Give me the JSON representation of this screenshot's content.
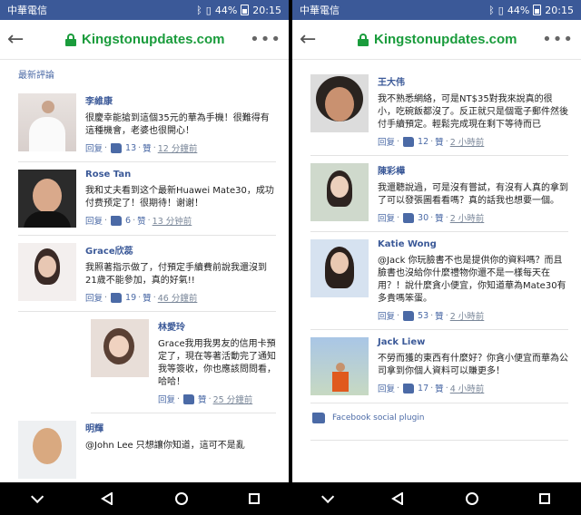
{
  "status": {
    "carrier": "中華電信",
    "signal": "⁴ᴳ",
    "battery": "44%",
    "time": "20:15"
  },
  "urlbar": {
    "domain": "Kingstonupdates.com",
    "more": "•••"
  },
  "left": {
    "section_title": "最新評論",
    "comments": [
      {
        "author": "李維康",
        "text": "很慶幸能搶到這個35元的華為手機！很難得有這種機會，老婆也很開心！",
        "reply": "回复",
        "likes": "13",
        "praise": "贊",
        "time": "12 分鐘前",
        "avatar": "av-wedding",
        "indent": false
      },
      {
        "author": "Rose Tan",
        "text": "我和丈夫看到这个最新Huawei Mate30，成功付费预定了！很期待！谢谢！",
        "reply": "回复",
        "likes": "6",
        "praise": "赞",
        "time": "13 分钟前",
        "avatar": "av-rose",
        "indent": false
      },
      {
        "author": "Grace欣蕊",
        "text": "我照著指示做了，付預定手續費前說我還沒到21歲不能參加，真的好氣!!",
        "reply": "回复",
        "likes": "19",
        "praise": "贊",
        "time": "46 分鐘前",
        "avatar": "av-grace",
        "indent": false
      },
      {
        "author": "林愛玲",
        "text": "Grace我用我男友的信用卡預定了，現在等著活動完了通知我等簽收，你也應該問問看，哈哈！",
        "reply": "回复",
        "likes": "",
        "praise": "贊",
        "time": "25 分鐘前",
        "avatar": "av-lin",
        "indent": true
      },
      {
        "author": "明輝",
        "text": "@John Lee 只想讓你知道，這可不是亂",
        "reply": "",
        "likes": "",
        "praise": "",
        "time": "",
        "avatar": "av-ming",
        "indent": false
      }
    ]
  },
  "right": {
    "comments": [
      {
        "author": "王大伟",
        "text": "我不熟悉網絡，可是NT$35對我來說真的很小，吃碗飯都沒了。反正就只是個電子郵件然後付手續預定。輕鬆完成現在剩下等待而已",
        "reply": "回复",
        "likes": "12",
        "praise": "贊",
        "time": "2 小時前",
        "avatar": "av-wang",
        "indent": false
      },
      {
        "author": "陳彩樺",
        "text": "我還聽說過，可是沒有嘗試，有沒有人真的拿到了可以發張圖看看嗎？真的話我也想要一個。",
        "reply": "回复",
        "likes": "30",
        "praise": "贊",
        "time": "2 小時前",
        "avatar": "av-chen",
        "indent": false
      },
      {
        "author": "Katie Wong",
        "text": "@Jack 你玩臉書不也是提供你的資料嗎？而且臉書也沒給你什麼禮物你還不是一樣每天在用？！說什麼貪小便宜，你知道華為Mate30有多貴嗎笨蛋。",
        "reply": "回复",
        "likes": "53",
        "praise": "贊",
        "time": "2 小時前",
        "avatar": "av-katie",
        "indent": false
      },
      {
        "author": "Jack Liew",
        "text": "不勞而獲的東西有什麼好？你貪小便宜而華為公司拿到你個人資料可以賺更多！",
        "reply": "回复",
        "likes": "17",
        "praise": "贊",
        "time": "4 小時前",
        "avatar": "av-jack",
        "indent": false
      }
    ],
    "plugin_label": "Facebook social plugin"
  }
}
